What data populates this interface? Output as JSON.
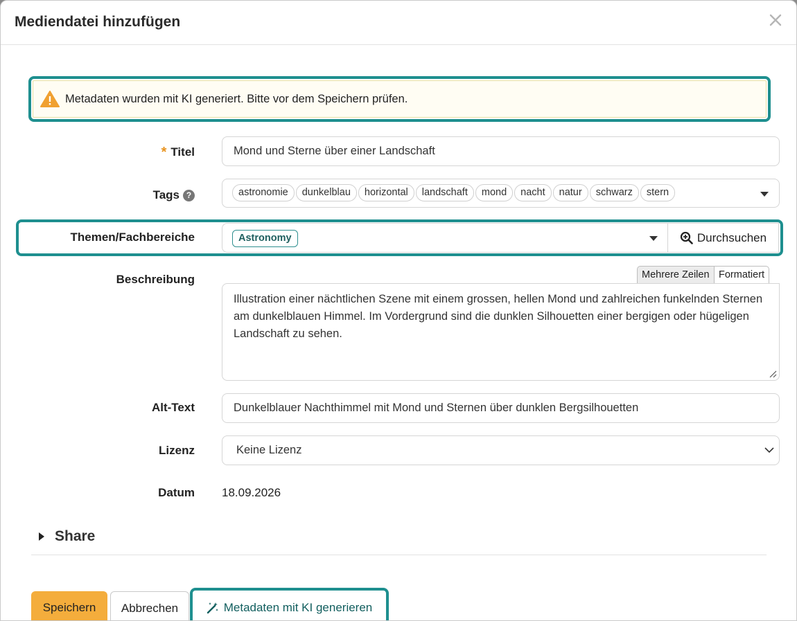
{
  "dialog": {
    "title": "Mediendatei hinzufügen",
    "close_icon": "close-icon"
  },
  "alert": {
    "icon": "warning-icon",
    "text": "Metadaten wurden mit KI generiert. Bitte vor dem Speichern prüfen."
  },
  "form": {
    "title": {
      "label": "Titel",
      "required_marker": "*",
      "value": "Mond und Sterne über einer Landschaft"
    },
    "tags": {
      "label": "Tags",
      "help_icon": "?",
      "items": [
        "astronomie",
        "dunkelblau",
        "horizontal",
        "landschaft",
        "mond",
        "nacht",
        "natur",
        "schwarz",
        "stern"
      ]
    },
    "subjects": {
      "label": "Themen/Fachbereiche",
      "chip": "Astronomy",
      "browse_label": "Durchsuchen"
    },
    "description": {
      "label": "Beschreibung",
      "mode_multiline": "Mehrere Zeilen",
      "mode_formatted": "Formatiert",
      "value": "Illustration einer nächtlichen Szene mit einem grossen, hellen Mond und zahlreichen funkelnden Sternen am dunkelblauen Himmel. Im Vordergrund sind die dunklen Silhouetten einer bergigen oder hügeligen Landschaft zu sehen."
    },
    "alt_text": {
      "label": "Alt-Text",
      "value": "Dunkelblauer Nachthimmel mit Mond und Sternen über dunklen Bergsilhouetten"
    },
    "license": {
      "label": "Lizenz",
      "value": "Keine Lizenz"
    },
    "date": {
      "label": "Datum",
      "value": "18.09.2026"
    }
  },
  "share": {
    "label": "Share"
  },
  "footer": {
    "save_label": "Speichern",
    "cancel_label": "Abbrechen",
    "ai_label": "Metadaten mit KI generieren"
  },
  "colors": {
    "accent_teal": "#1e8f8f",
    "save_button": "#f4ad3c",
    "required_star": "#e8931e",
    "alert_bg": "#fffdf3"
  }
}
